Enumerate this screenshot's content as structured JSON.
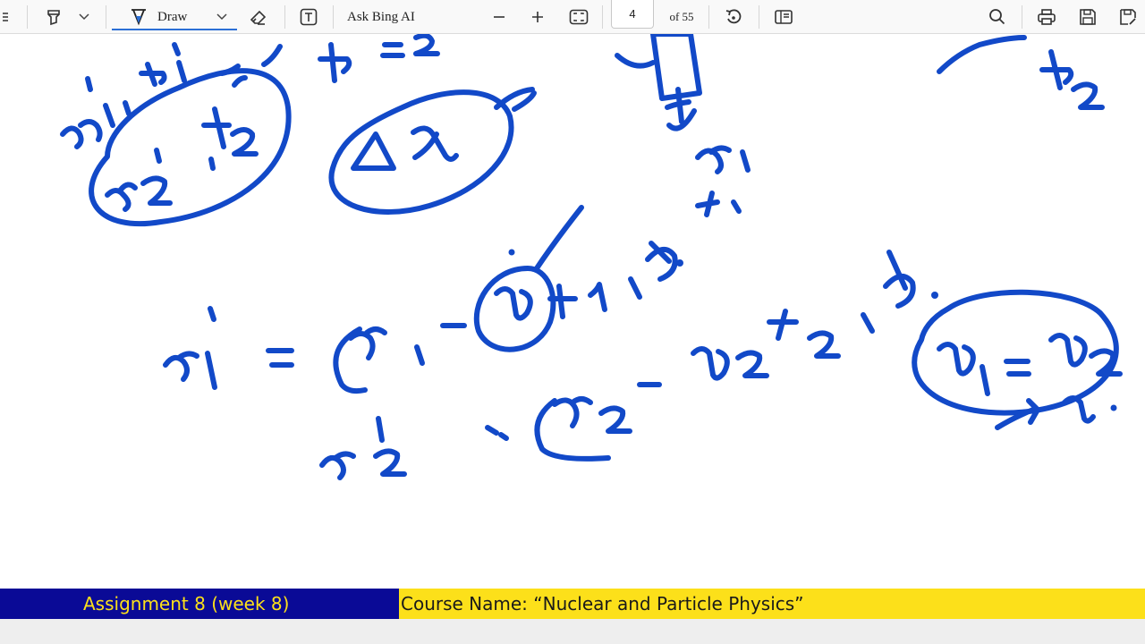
{
  "toolbar": {
    "draw_label": "Draw",
    "ask_bing_label": "Ask Bing AI",
    "page_number": "4",
    "page_total_label": "of 55"
  },
  "footer": {
    "assignment": "Assignment 8 (week 8)",
    "course": "Course Name:  “Nuclear and Particle Physics”"
  },
  "colors": {
    "ink": "#1249c8",
    "footer_left_bg": "#0a0a96",
    "footer_right_bg": "#fce01a",
    "footer_left_text": "#fce01a"
  }
}
